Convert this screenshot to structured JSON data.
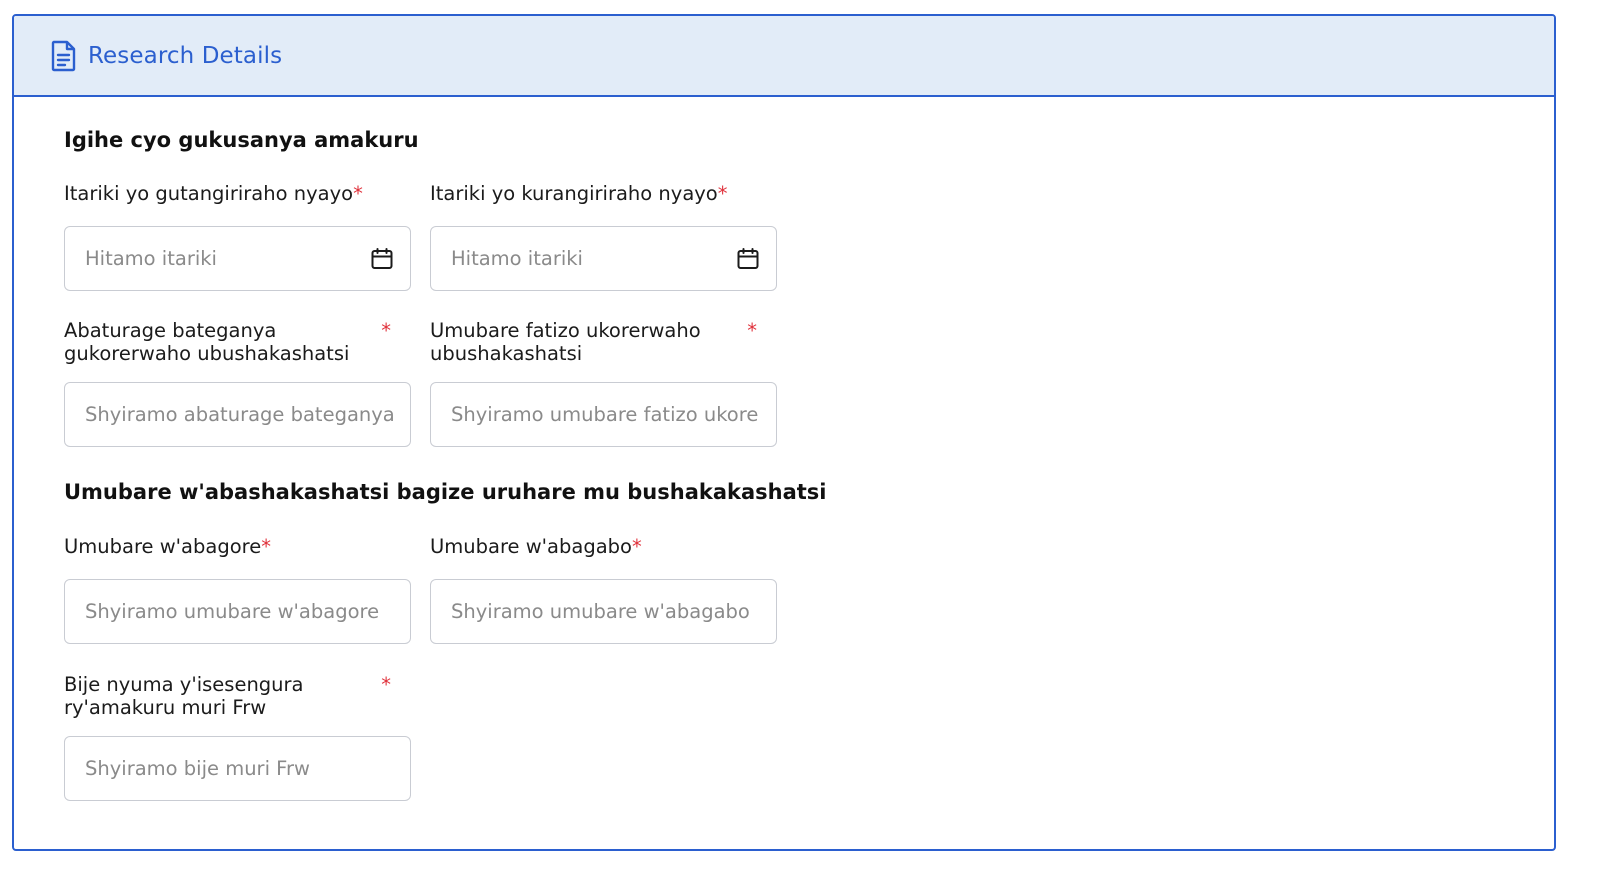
{
  "header": {
    "title": "Research Details",
    "icon": "document-icon",
    "accent_color": "#2b5fcf",
    "background_color": "#e2ecf8"
  },
  "sections": [
    {
      "title": "Igihe cyo gukusanya amakuru"
    },
    {
      "title": "Umubare w'abashakashatsi bagize uruhare mu bushakakashatsi"
    }
  ],
  "fields": {
    "start_date": {
      "label": "Itariki yo gutangiriraho nyayo",
      "required_mark": "*",
      "placeholder": "Hitamo itariki",
      "icon": "calendar-icon"
    },
    "end_date": {
      "label": "Itariki yo kurangiriraho nyayo",
      "required_mark": "*",
      "placeholder": "Hitamo itariki",
      "icon": "calendar-icon"
    },
    "target_population": {
      "label": "Abaturage bateganya gukorerwaho ubushakashatsi",
      "required_mark": "*",
      "placeholder": "Shyiramo abaturage bateganya"
    },
    "sample_size": {
      "label": "Umubare fatizo ukorerwaho ubushakashatsi",
      "required_mark": "*",
      "placeholder": "Shyiramo umubare fatizo ukorerwaho"
    },
    "female_count": {
      "label": "Umubare w'abagore",
      "required_mark": "*",
      "placeholder": "Shyiramo umubare w'abagore"
    },
    "male_count": {
      "label": "Umubare w'abagabo",
      "required_mark": "*",
      "placeholder": "Shyiramo umubare w'abagabo"
    },
    "budget": {
      "label": "Bije nyuma y'isesengura ry'amakuru muri Frw",
      "required_mark": "*",
      "placeholder": "Shyiramo bije muri Frw"
    }
  }
}
